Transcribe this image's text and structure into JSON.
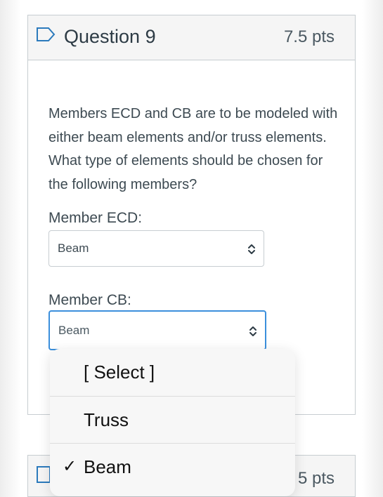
{
  "question": {
    "title": "Question 9",
    "points": "7.5 pts",
    "text": "Members ECD and CB are to be modeled with either beam elements and/or truss elements. What type of elements should be chosen for the following members?"
  },
  "members": [
    {
      "label": "Member ECD:",
      "selected": "Beam"
    },
    {
      "label": "Member CB:",
      "selected": "Beam"
    }
  ],
  "dropdown": {
    "options": [
      "[ Select ]",
      "Truss",
      "Beam"
    ],
    "checked": "Beam",
    "check_glyph": "✓"
  },
  "next_question": {
    "points_partial": "5 pts"
  },
  "colors": {
    "focus_border": "#3b8fdc",
    "header_bg": "#f5f5f5",
    "text": "#2d3b45"
  }
}
